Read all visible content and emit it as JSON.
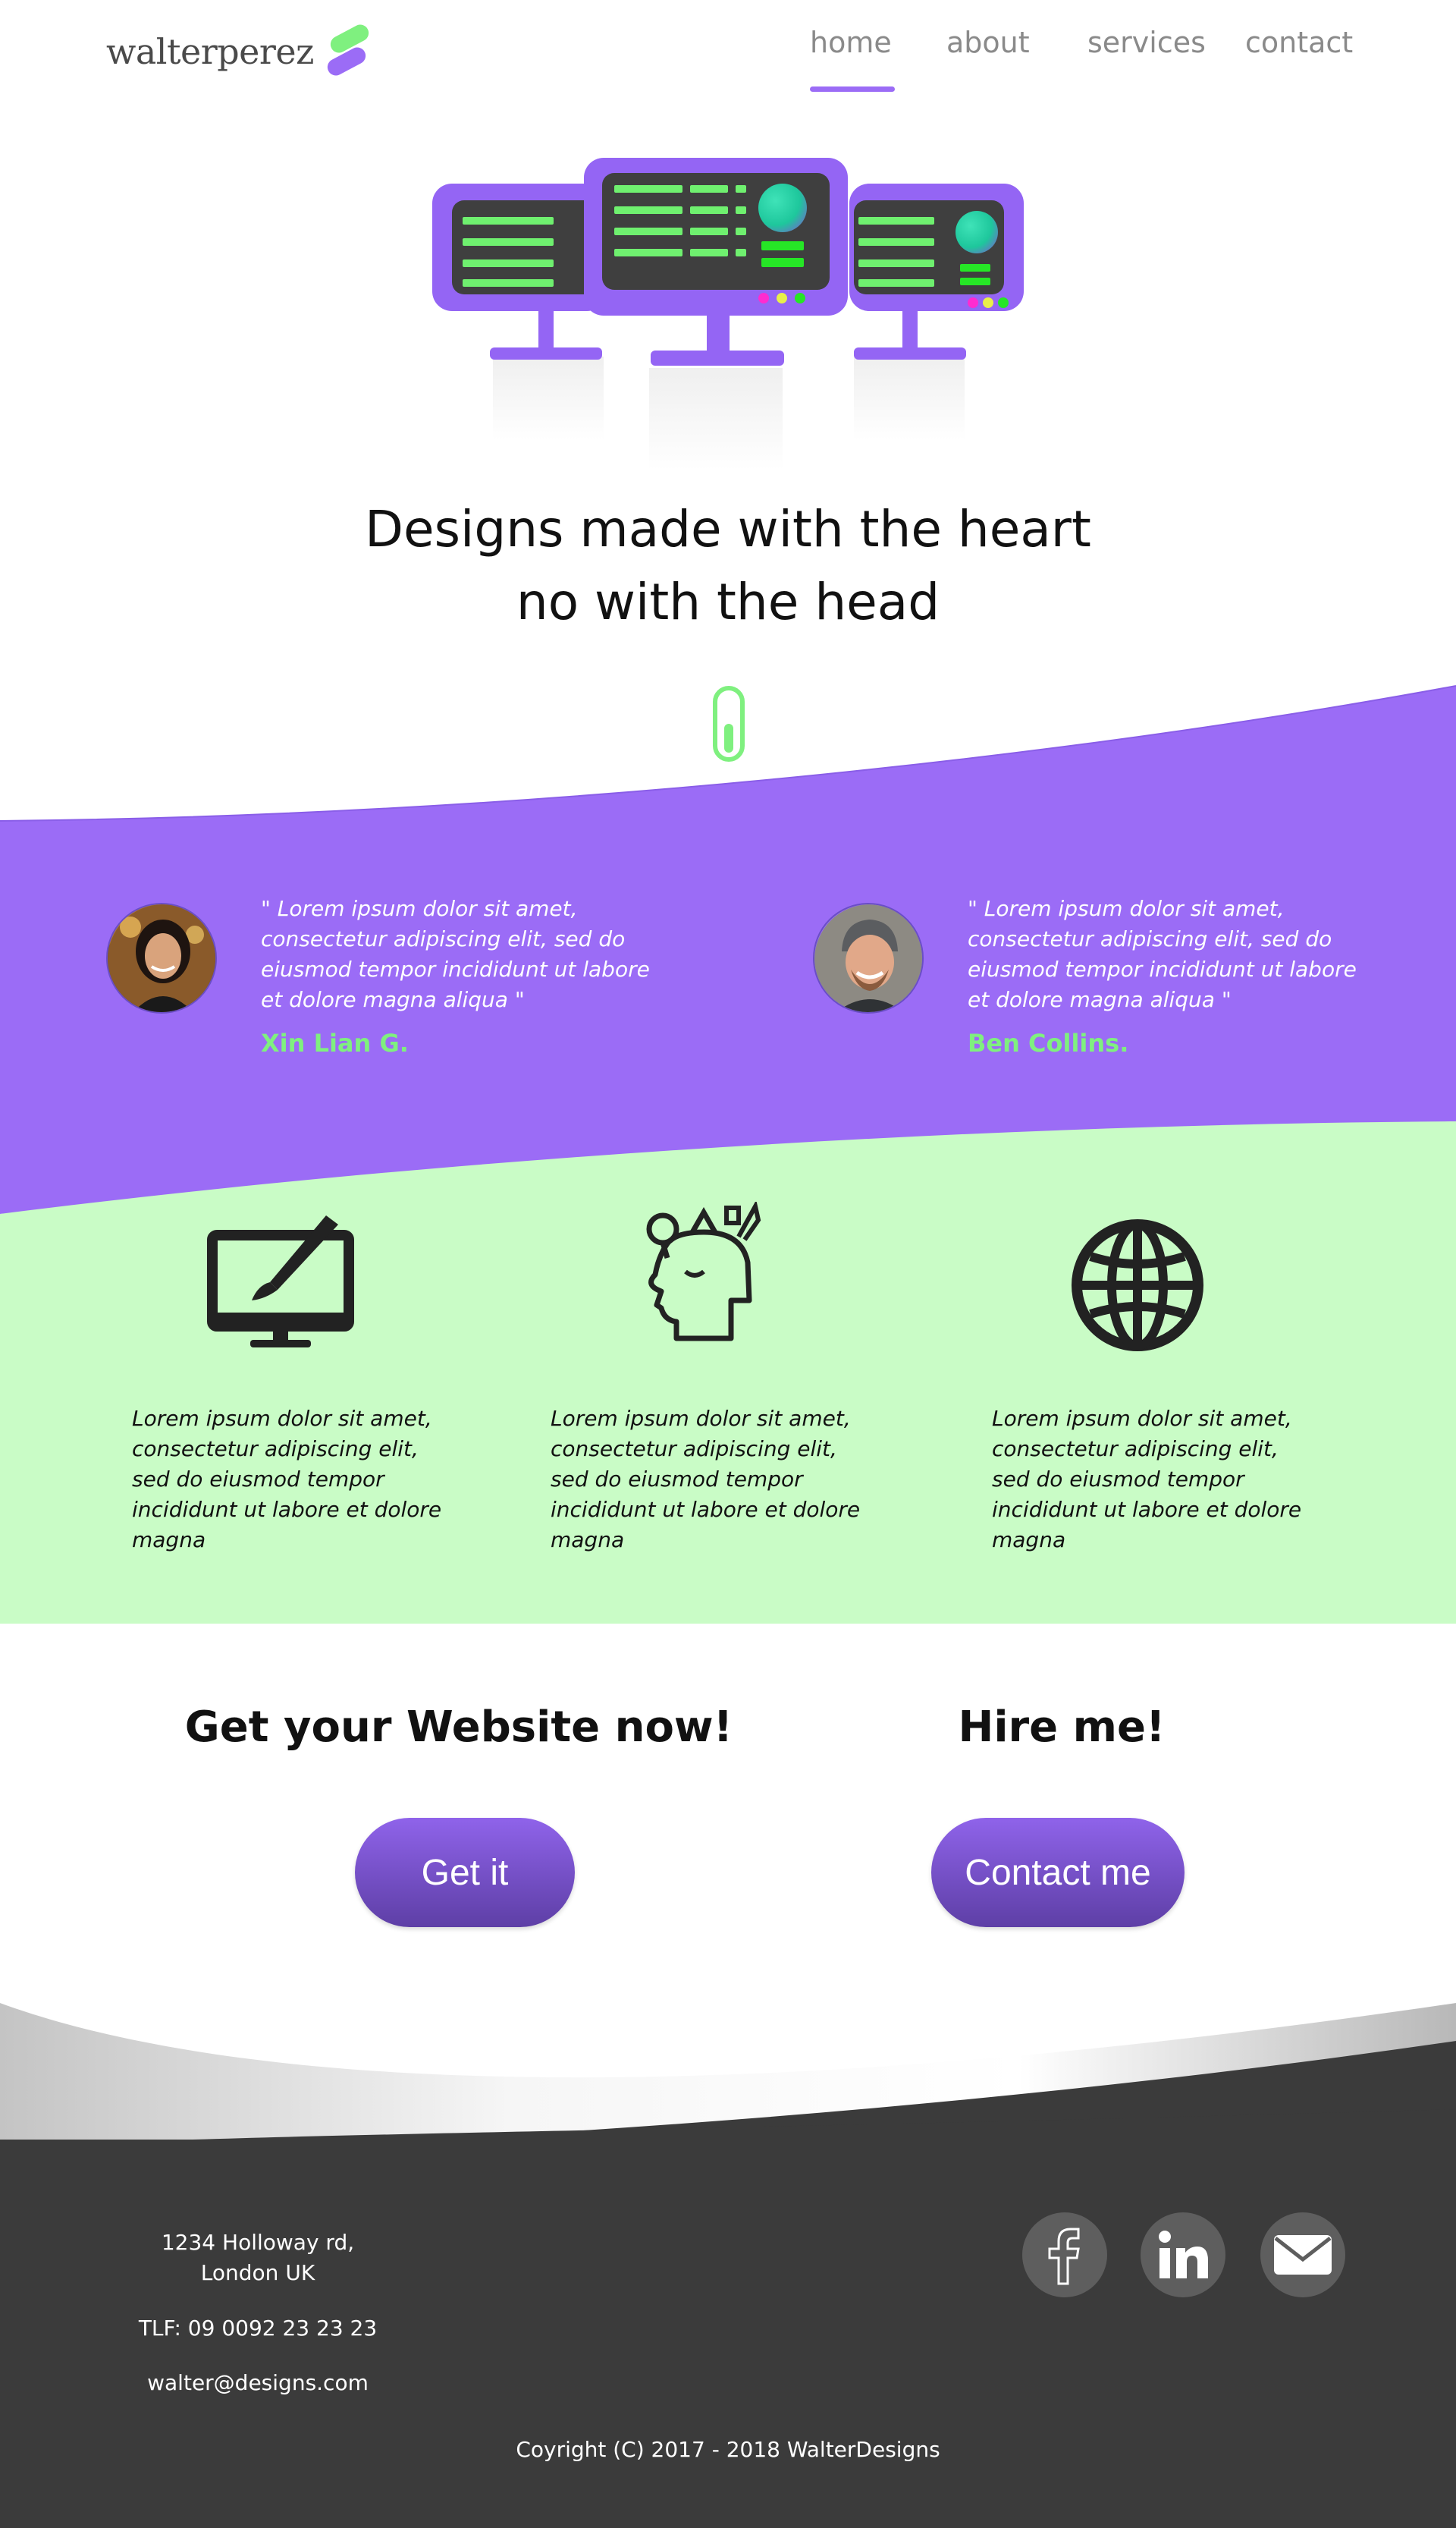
{
  "brand": {
    "name": "walterperez",
    "accent_purple": "#9b6cf6",
    "accent_green": "#7ff07f",
    "footer_bg": "#3b3b3b",
    "features_bg": "#c9fcc6"
  },
  "nav": {
    "items": [
      {
        "label": "home",
        "active": true
      },
      {
        "label": "about",
        "active": false
      },
      {
        "label": "services",
        "active": false
      },
      {
        "label": "contact",
        "active": false
      }
    ]
  },
  "hero": {
    "title_line1": "Designs made with the heart",
    "title_line2": "no with the head",
    "scroll_icon": "mouse-scroll-icon"
  },
  "testimonials": [
    {
      "quote": "\" Lorem ipsum dolor sit amet, consectetur adipiscing elit, sed do eiusmod tempor incididunt ut labore et dolore magna aliqua \"",
      "author": "Xin Lian G."
    },
    {
      "quote": "\" Lorem ipsum dolor sit amet, consectetur adipiscing elit, sed do eiusmod tempor incididunt ut labore et dolore magna aliqua \"",
      "author": "Ben Collins."
    }
  ],
  "features": [
    {
      "icon": "monitor-brush-icon",
      "text": "Lorem ipsum dolor sit amet, consectetur adipiscing elit, sed do eiusmod tempor incididunt ut labore et dolore magna"
    },
    {
      "icon": "creative-head-icon",
      "text": "Lorem ipsum dolor sit amet, consectetur adipiscing elit, sed do eiusmod tempor incididunt ut labore et dolore magna"
    },
    {
      "icon": "globe-icon",
      "text": " Lorem ipsum dolor sit amet, consectetur adipiscing elit, sed do eiusmod tempor incididunt ut labore et dolore magna"
    }
  ],
  "cta": {
    "website_heading": "Get your Website now!",
    "website_button": "Get it",
    "hire_heading": "Hire me!",
    "hire_button": "Contact me"
  },
  "footer": {
    "address_line1": "1234 Holloway rd,",
    "address_line2": "London UK",
    "phone": "TLF: 09 0092 23 23 23",
    "email": "walter@designs.com",
    "copyright": "Coyright (C) 2017 - 2018 WalterDesigns",
    "social_icons": [
      "facebook-icon",
      "linkedin-icon",
      "mail-icon"
    ]
  }
}
